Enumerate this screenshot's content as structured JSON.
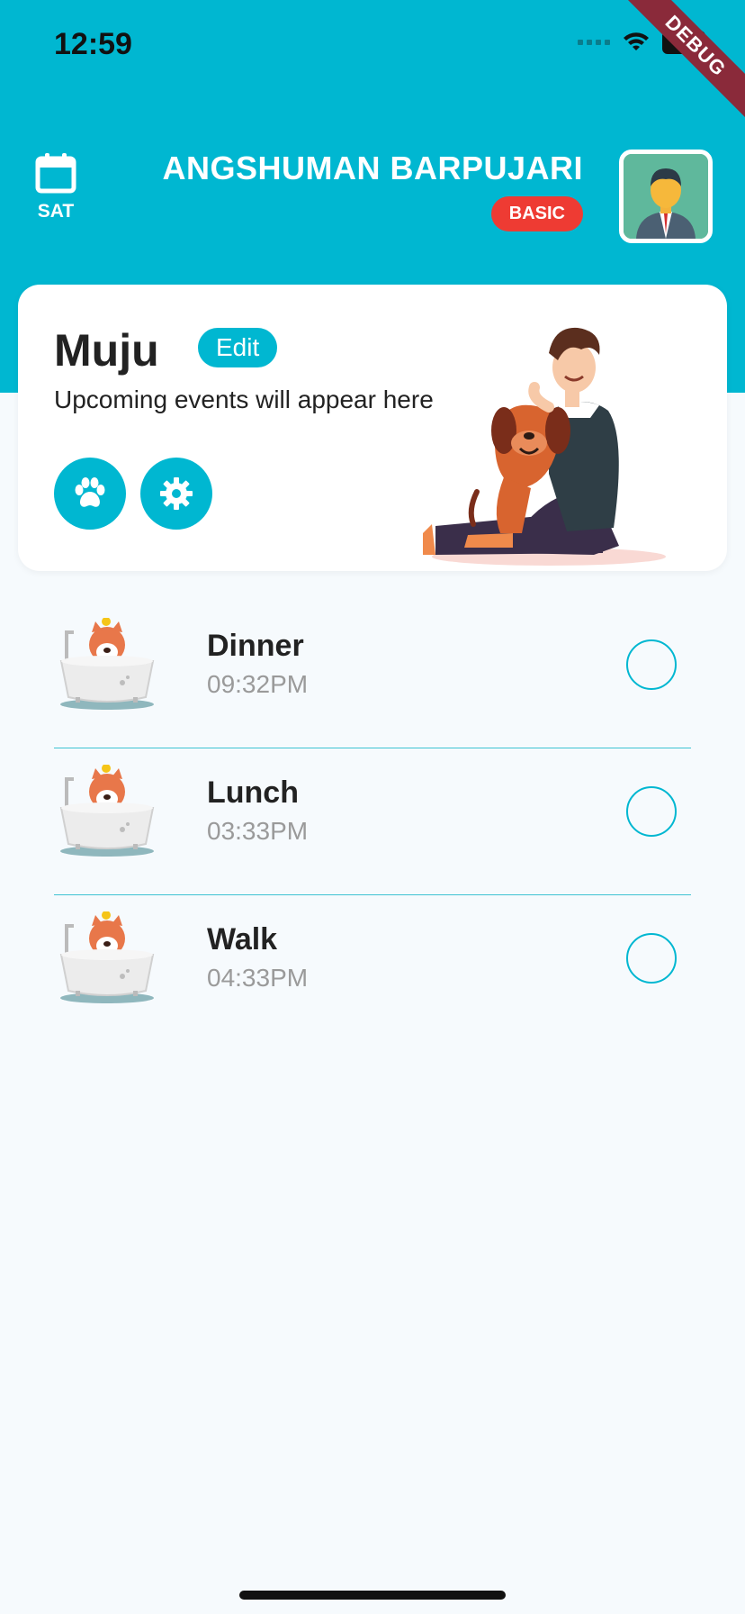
{
  "status_bar": {
    "time": "12:59"
  },
  "debug_banner": "DEBUG",
  "header": {
    "day": "SAT",
    "user_name": "ANGSHUMAN BARPUJARI",
    "plan": "BASIC"
  },
  "pet_card": {
    "pet_name": "Muju",
    "edit_label": "Edit",
    "upcoming_text": "Upcoming events will appear here"
  },
  "tasks": [
    {
      "title": "Dinner",
      "time": "09:32PM",
      "done": false
    },
    {
      "title": "Lunch",
      "time": "03:33PM",
      "done": false
    },
    {
      "title": "Walk",
      "time": "04:33PM",
      "done": false
    }
  ],
  "colors": {
    "accent": "#00b7d1",
    "badge": "#ee3b33",
    "background": "#f6fafd"
  }
}
